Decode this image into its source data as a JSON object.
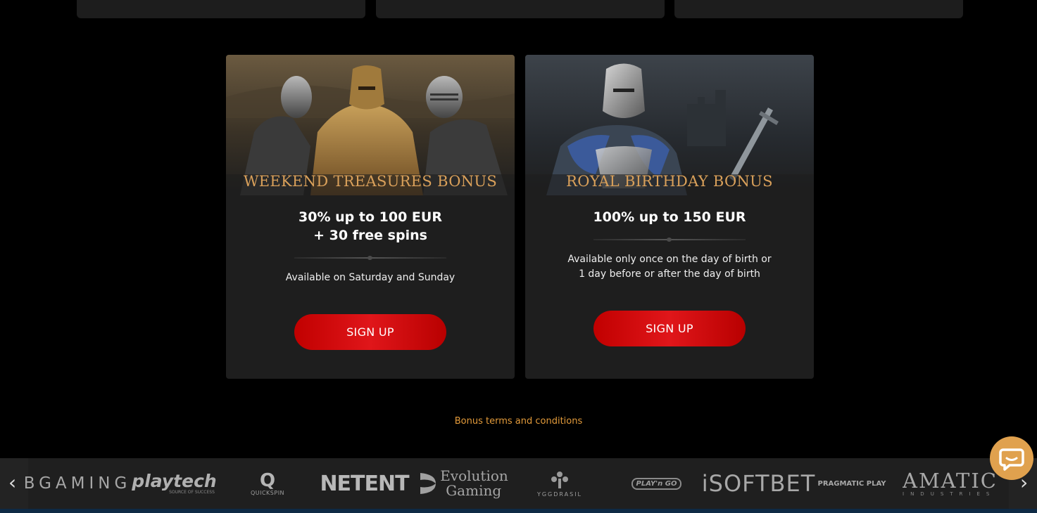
{
  "cards": [
    {
      "title": "Weekend Treasures Bonus",
      "amount": "30% up to 100 EUR\n+ 30 free spins",
      "description": "Available on Saturday and Sunday",
      "button": "SIGN UP"
    },
    {
      "title": "Royal Birthday Bonus",
      "amount": "100% up to 150 EUR",
      "description": "Available only once on the day of birth or 1 day before or after the day of birth",
      "button": "SIGN UP"
    }
  ],
  "terms_link": "Bonus terms and conditions",
  "providers": {
    "bgaming": "BGAMING",
    "playtech": "playtech",
    "playtech_tagline": "SOURCE OF SUCCESS",
    "quickspin": "QUICKSPIN",
    "netent": "NETENT",
    "evolution_line1": "Evolution",
    "evolution_line2": "Gaming",
    "yggdrasil": "YGGDRASIL",
    "playngo": "PLAY'n GO",
    "isoftbet": "iSOFTBET",
    "pragmatic": "PRAGMATIC PLAY",
    "amatic": "AMATIC",
    "amatic_sub": "INDUSTRIES"
  },
  "icons": {
    "prev": "chevron-left-icon",
    "next": "chevron-right-icon",
    "chat": "chat-bubble-icon"
  },
  "colors": {
    "accent_gold": "#d9a05a",
    "signup_red": "#d10a0e",
    "terms_orange": "#e29a3a",
    "chat_orange": "#e0a14e"
  }
}
